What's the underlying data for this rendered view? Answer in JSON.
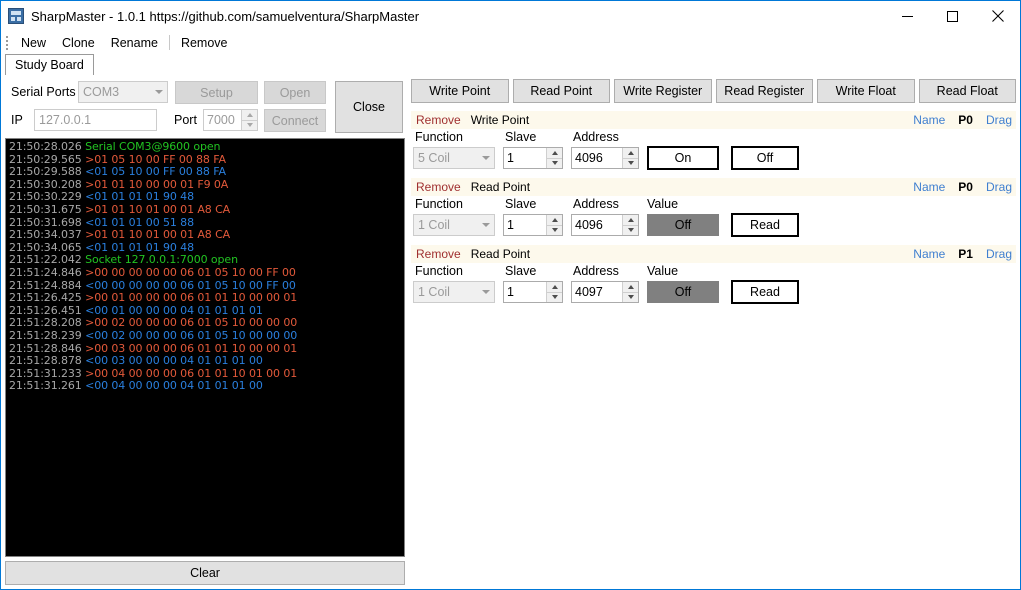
{
  "window": {
    "title": "SharpMaster - 1.0.1 https://github.com/samuelventura/SharpMaster",
    "icon": "app-icon",
    "minimize": "─",
    "maximize": "□",
    "close": "✕"
  },
  "menu": {
    "items": [
      {
        "label": "New"
      },
      {
        "label": "Clone"
      },
      {
        "label": "Rename"
      },
      {
        "label": "Remove"
      }
    ]
  },
  "tabs": [
    {
      "label": "Study Board",
      "selected": true
    }
  ],
  "connection": {
    "serial_ports_label": "Serial Ports",
    "serial_ports_value": "COM3",
    "setup_label": "Setup",
    "open_label": "Open",
    "close_label": "Close",
    "ip_label": "IP",
    "ip_value": "127.0.0.1",
    "port_label": "Port",
    "port_value": "7000",
    "connect_label": "Connect"
  },
  "console": {
    "clear_label": "Clear",
    "lines": [
      {
        "ts": "21:50:28.026",
        "text": "Serial COM3@9600 open",
        "color": "#22c322"
      },
      {
        "ts": "21:50:29.565",
        "text": ">01 05 10 00 FF 00 88 FA",
        "color": "#e2593a"
      },
      {
        "ts": "21:50:29.588",
        "text": "<01 05 10 00 FF 00 88 FA",
        "color": "#2a7fdd"
      },
      {
        "ts": "21:50:30.208",
        "text": ">01 01 10 00 00 01 F9 0A",
        "color": "#e2593a"
      },
      {
        "ts": "21:50:30.229",
        "text": "<01 01 01 01 90 48",
        "color": "#2a7fdd"
      },
      {
        "ts": "21:50:31.675",
        "text": ">01 01 10 01 00 01 A8 CA",
        "color": "#e2593a"
      },
      {
        "ts": "21:50:31.698",
        "text": "<01 01 01 00 51 88",
        "color": "#2a7fdd"
      },
      {
        "ts": "21:50:34.037",
        "text": ">01 01 10 01 00 01 A8 CA",
        "color": "#e2593a"
      },
      {
        "ts": "21:50:34.065",
        "text": "<01 01 01 01 90 48",
        "color": "#2a7fdd"
      },
      {
        "ts": "21:51:22.042",
        "text": "Socket 127.0.0.1:7000 open",
        "color": "#22c322"
      },
      {
        "ts": "21:51:24.846",
        "text": ">00 00 00 00 00 06 01 05 10 00 FF 00",
        "color": "#e2593a"
      },
      {
        "ts": "21:51:24.884",
        "text": "<00 00 00 00 00 06 01 05 10 00 FF 00",
        "color": "#2a7fdd"
      },
      {
        "ts": "21:51:26.425",
        "text": ">00 01 00 00 00 06 01 01 10 00 00 01",
        "color": "#e2593a"
      },
      {
        "ts": "21:51:26.451",
        "text": "<00 01 00 00 00 04 01 01 01 01",
        "color": "#2a7fdd"
      },
      {
        "ts": "21:51:28.208",
        "text": ">00 02 00 00 00 06 01 05 10 00 00 00",
        "color": "#e2593a"
      },
      {
        "ts": "21:51:28.239",
        "text": "<00 02 00 00 00 06 01 05 10 00 00 00",
        "color": "#2a7fdd"
      },
      {
        "ts": "21:51:28.846",
        "text": ">00 03 00 00 00 06 01 01 10 00 00 01",
        "color": "#e2593a"
      },
      {
        "ts": "21:51:28.878",
        "text": "<00 03 00 00 00 04 01 01 01 00",
        "color": "#2a7fdd"
      },
      {
        "ts": "21:51:31.233",
        "text": ">00 04 00 00 00 06 01 01 10 01 00 01",
        "color": "#e2593a"
      },
      {
        "ts": "21:51:31.261",
        "text": "<00 04 00 00 00 04 01 01 01 00",
        "color": "#2a7fdd"
      }
    ]
  },
  "toolbar": {
    "buttons": [
      {
        "label": "Write Point"
      },
      {
        "label": "Read Point"
      },
      {
        "label": "Write Register"
      },
      {
        "label": "Read Register"
      },
      {
        "label": "Write Float"
      },
      {
        "label": "Read Float"
      }
    ]
  },
  "labels": {
    "remove": "Remove",
    "name": "Name",
    "drag": "Drag",
    "function": "Function",
    "slave": "Slave",
    "address": "Address",
    "value": "Value"
  },
  "points": [
    {
      "kind": "Write Point",
      "id": "P0",
      "function": "5 Coil",
      "slave": "1",
      "address": "4096",
      "has_value": false,
      "actions": [
        {
          "label": "On"
        },
        {
          "label": "Off"
        }
      ]
    },
    {
      "kind": "Read Point",
      "id": "P0",
      "function": "1 Coil",
      "slave": "1",
      "address": "4096",
      "has_value": true,
      "value": "Off",
      "actions": [
        {
          "label": "Read"
        }
      ]
    },
    {
      "kind": "Read Point",
      "id": "P1",
      "function": "1 Coil",
      "slave": "1",
      "address": "4097",
      "has_value": true,
      "value": "Off",
      "actions": [
        {
          "label": "Read"
        }
      ]
    }
  ],
  "colors": {
    "accent": "#0078d7",
    "header_bg": "#fdf9ec",
    "remove": "#a03030",
    "link": "#3f7fd0",
    "tx": "#e2593a",
    "rx": "#2a7fdd",
    "info": "#22c322",
    "timestamp": "#a8a8a8"
  }
}
